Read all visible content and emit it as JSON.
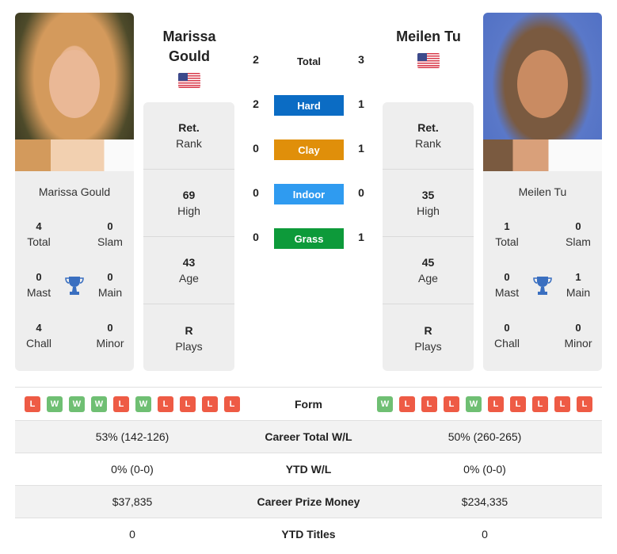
{
  "player1": {
    "name_heading_line1": "Marissa",
    "name_heading_line2": "Gould",
    "name": "Marissa Gould",
    "country_flag": "us-flag-icon",
    "titles": {
      "total": "4",
      "slam": "0",
      "mast": "0",
      "main": "0",
      "chall": "4",
      "minor": "0"
    },
    "rank": {
      "value": "Ret.",
      "label": "Rank"
    },
    "high": {
      "value": "69",
      "label": "High"
    },
    "age": {
      "value": "43",
      "label": "Age"
    },
    "plays": {
      "value": "R",
      "label": "Plays"
    },
    "form": [
      "L",
      "W",
      "W",
      "W",
      "L",
      "W",
      "L",
      "L",
      "L",
      "L"
    ],
    "career_wl": "53% (142-126)",
    "ytd_wl": "0% (0-0)",
    "prize_money": "$37,835",
    "ytd_titles": "0"
  },
  "player2": {
    "name_heading": "Meilen Tu",
    "name": "Meilen Tu",
    "country_flag": "us-flag-icon",
    "titles": {
      "total": "1",
      "slam": "0",
      "mast": "0",
      "main": "1",
      "chall": "0",
      "minor": "0"
    },
    "rank": {
      "value": "Ret.",
      "label": "Rank"
    },
    "high": {
      "value": "35",
      "label": "High"
    },
    "age": {
      "value": "45",
      "label": "Age"
    },
    "plays": {
      "value": "R",
      "label": "Plays"
    },
    "form": [
      "W",
      "L",
      "L",
      "L",
      "W",
      "L",
      "L",
      "L",
      "L",
      "L"
    ],
    "career_wl": "50% (260-265)",
    "ytd_wl": "0% (0-0)",
    "prize_money": "$234,335",
    "ytd_titles": "0"
  },
  "title_labels": {
    "total": "Total",
    "slam": "Slam",
    "mast": "Mast",
    "main": "Main",
    "chall": "Chall",
    "minor": "Minor"
  },
  "h2h": {
    "total": {
      "label": "Total",
      "p1": "2",
      "p2": "3"
    },
    "surfaces": [
      {
        "label": "Hard",
        "p1": "2",
        "p2": "1",
        "color": "#0b6cc4"
      },
      {
        "label": "Clay",
        "p1": "0",
        "p2": "1",
        "color": "#e08f0a"
      },
      {
        "label": "Indoor",
        "p1": "0",
        "p2": "0",
        "color": "#2f9bf0"
      },
      {
        "label": "Grass",
        "p1": "0",
        "p2": "1",
        "color": "#0d9a3a"
      }
    ]
  },
  "table": {
    "form_label": "Form",
    "career_wl_label": "Career Total W/L",
    "ytd_wl_label": "YTD W/L",
    "prize_money_label": "Career Prize Money",
    "ytd_titles_label": "YTD Titles"
  },
  "colors": {
    "win": "#6fbf73",
    "loss": "#ee5b45",
    "card_bg": "#eeeeee"
  }
}
